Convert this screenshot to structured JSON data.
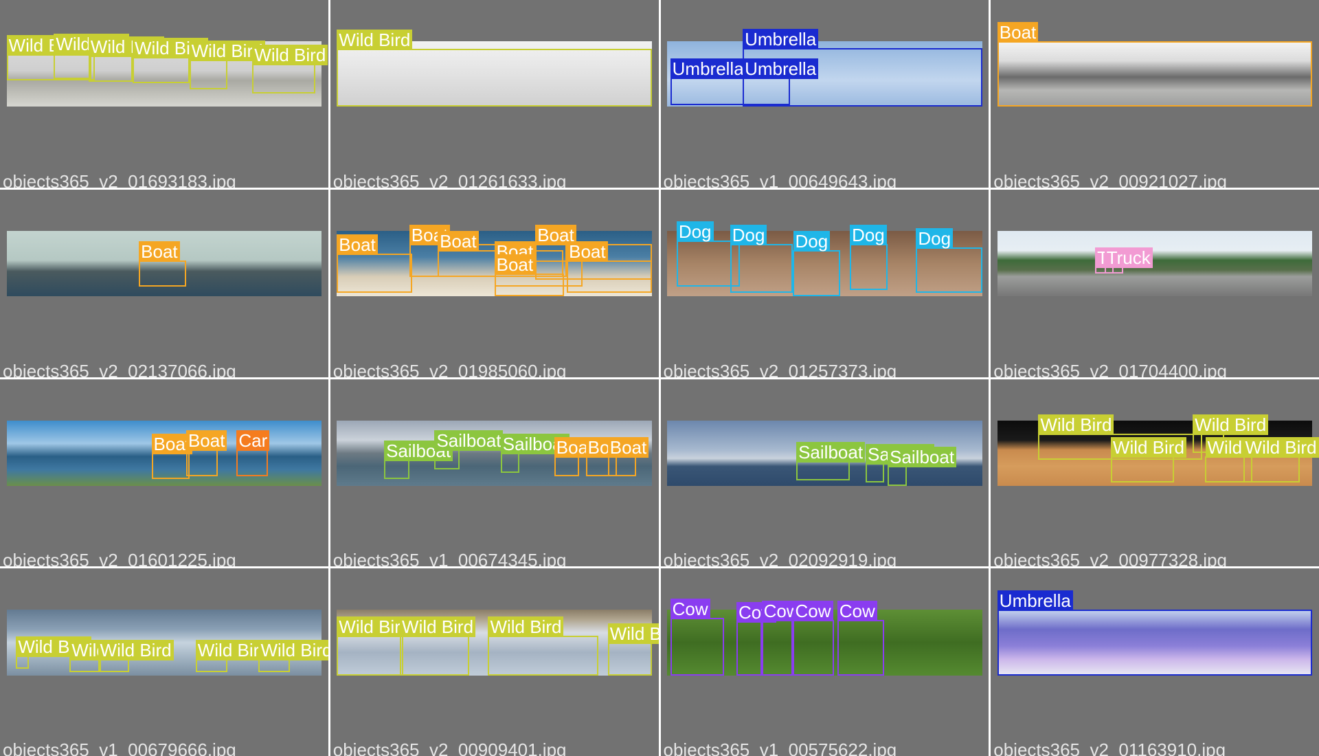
{
  "class_colors": {
    "Wild Bird": "#c8cf33",
    "Umbrella": "#1a2bd0",
    "Boat": "#f5a623",
    "Dog": "#1fb6e8",
    "Truck": "#f29bd3",
    "Sailboat": "#8cc63f",
    "Car": "#f57c1f",
    "Cow": "#8a3df0"
  },
  "tiles": [
    {
      "filename": "objects365_v2_01693183.jpg",
      "scene": "beach-birds",
      "labels": [
        "Wild Bird",
        "Wild Bird",
        "Wild Bird",
        "Wild Bird",
        "Wild Bird",
        "Wild Bird"
      ]
    },
    {
      "filename": "objects365_v2_01261633.jpg",
      "scene": "snow-flock",
      "labels": [
        "Wild Bird"
      ]
    },
    {
      "filename": "objects365_v1_00649643.jpg",
      "scene": "red-umbrella",
      "labels": [
        "Umbrella",
        "Umbrella",
        "Umbrella"
      ]
    },
    {
      "filename": "objects365_v2_00921027.jpg",
      "scene": "marina",
      "labels": [
        "Boat"
      ]
    },
    {
      "filename": "objects365_v2_02137066.jpg",
      "scene": "skyline",
      "labels": [
        "Boat"
      ]
    },
    {
      "filename": "objects365_v2_01985060.jpg",
      "scene": "beach-boats",
      "labels": [
        "Boat",
        "Boat",
        "Boat",
        "Boat",
        "Boat",
        "Boat",
        "Boat"
      ]
    },
    {
      "filename": "objects365_v2_01257373.jpg",
      "scene": "puppies",
      "labels": [
        "Dog",
        "Dog",
        "Dog",
        "Dog",
        "Dog"
      ]
    },
    {
      "filename": "objects365_v2_01704400.jpg",
      "scene": "highway",
      "labels": [
        "Truck",
        "Truck"
      ]
    },
    {
      "filename": "objects365_v2_01601225.jpg",
      "scene": "bay",
      "labels": [
        "Boat",
        "Boat",
        "Car"
      ]
    },
    {
      "filename": "objects365_v1_00674345.jpg",
      "scene": "harbor",
      "labels": [
        "Sailboat",
        "Sailboat",
        "Sailboat",
        "Boat",
        "Boat",
        "Boat"
      ]
    },
    {
      "filename": "objects365_v2_02092919.jpg",
      "scene": "sea",
      "labels": [
        "Sailboat",
        "Sailboat",
        "Sailboat"
      ]
    },
    {
      "filename": "objects365_v2_00977328.jpg",
      "scene": "wetland",
      "labels": [
        "Wild Bird",
        "Wild Bird",
        "Wild Bird",
        "Wild Bird",
        "Wild Bird"
      ]
    },
    {
      "filename": "objects365_v1_00679666.jpg",
      "scene": "water-birds",
      "labels": [
        "Wild Bird",
        "Wild Bird",
        "Wild Bird",
        "Wild Bird",
        "Wild Bird"
      ]
    },
    {
      "filename": "objects365_v2_00909401.jpg",
      "scene": "ice-geese",
      "labels": [
        "Wild Bird",
        "Wild Bird",
        "Wild Bird",
        "Wild Bird"
      ]
    },
    {
      "filename": "objects365_v1_00575622.jpg",
      "scene": "cows",
      "labels": [
        "Cow",
        "Cow",
        "Cow",
        "Cow",
        "Cow"
      ]
    },
    {
      "filename": "objects365_v2_01163910.jpg",
      "scene": "parasols",
      "labels": [
        "Umbrella"
      ]
    }
  ]
}
